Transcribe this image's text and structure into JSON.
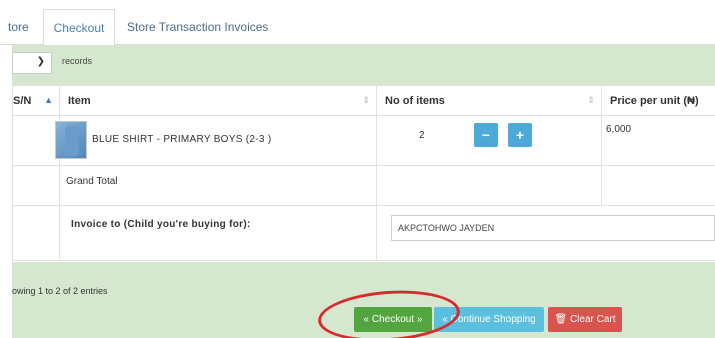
{
  "tabs": [
    {
      "label": "tore"
    },
    {
      "label": "Checkout"
    },
    {
      "label": "Store Transaction Invoices"
    }
  ],
  "length_menu": {
    "selected": "",
    "suffix": "records"
  },
  "table": {
    "headers": {
      "sn": "S/N",
      "item": "Item",
      "qty": "No of items",
      "price": "Price per unit (₦)"
    },
    "row": {
      "item_name": "BLUE SHIRT - PRIMARY BOYS (2-3 )",
      "quantity": "2",
      "price": "6,000"
    },
    "grand_total_label": "Grand Total",
    "invoice_label": "Invoice to (Child you're buying for):",
    "invoice_value": "AKPCTOHWO JAYDEN"
  },
  "footer": {
    "info": "owing 1 to 2 of 2 entries",
    "checkout_label": "« Checkout »",
    "continue_label": "« Continue Shopping",
    "clear_label": "Clear Cart"
  },
  "icons": {
    "minus": "minus-icon",
    "plus": "plus-icon",
    "trash": "trash-icon",
    "sort": "sort-icon",
    "chevron": "chevron-down-icon"
  },
  "colors": {
    "checkout": "#53a53f",
    "continue": "#5bc0de",
    "clear": "#d9534f",
    "qty_buttons": "#4ca9d8",
    "annotation": "#d62b2b",
    "panel": "#d6e7cf"
  }
}
